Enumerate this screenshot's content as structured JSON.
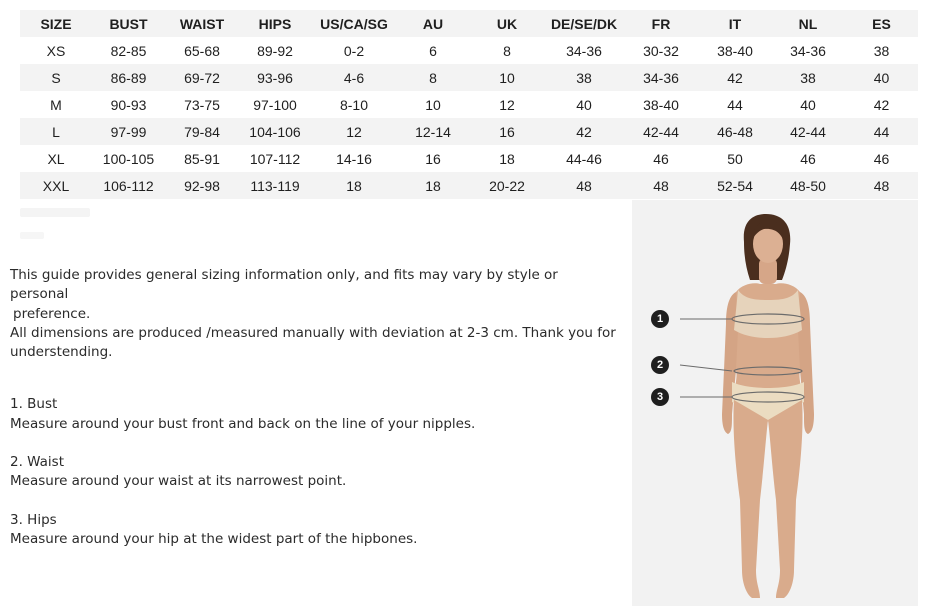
{
  "table": {
    "headers": [
      "SIZE",
      "BUST",
      "WAIST",
      "HIPS",
      "US/CA/SG",
      "AU",
      "UK",
      "DE/SE/DK",
      "FR",
      "IT",
      "NL",
      "ES"
    ],
    "rows": [
      [
        "XS",
        "82-85",
        "65-68",
        "89-92",
        "0-2",
        "6",
        "8",
        "34-36",
        "30-32",
        "38-40",
        "34-36",
        "38"
      ],
      [
        "S",
        "86-89",
        "69-72",
        "93-96",
        "4-6",
        "8",
        "10",
        "38",
        "34-36",
        "42",
        "38",
        "40"
      ],
      [
        "M",
        "90-93",
        "73-75",
        "97-100",
        "8-10",
        "10",
        "12",
        "40",
        "38-40",
        "44",
        "40",
        "42"
      ],
      [
        "L",
        "97-99",
        "79-84",
        "104-106",
        "12",
        "12-14",
        "16",
        "42",
        "42-44",
        "46-48",
        "42-44",
        "44"
      ],
      [
        "XL",
        "100-105",
        "85-91",
        "107-112",
        "14-16",
        "16",
        "18",
        "44-46",
        "46",
        "50",
        "46",
        "46"
      ],
      [
        "XXL",
        "106-112",
        "92-98",
        "113-119",
        "18",
        "18",
        "20-22",
        "48",
        "48",
        "52-54",
        "48-50",
        "48"
      ]
    ]
  },
  "guide": {
    "disclaimer_line1": "This guide provides general sizing information only, and fits may vary by style or personal",
    "disclaimer_line2": "preference.",
    "deviation_line1": "All dimensions are produced /measured manually with deviation at 2-3 cm. Thank you for",
    "deviation_line2": "understending.",
    "bust_title": "1. Bust",
    "bust_text": "Measure around your bust front and back on the line of your nipples.",
    "waist_title": "2. Waist",
    "waist_text": "Measure around your waist at its narrowest point.",
    "hips_title": "3. Hips",
    "hips_text": "Measure around your hip at the widest part of the hipbones."
  },
  "figure": {
    "marker_1": "1",
    "marker_2": "2",
    "marker_3": "3"
  },
  "colors": {
    "row_alt": "#f3f3f3",
    "panel_bg": "#f2f2f2",
    "marker": "#1f1f1f",
    "skin": "#d9ab8c",
    "garment": "#e6d3bb",
    "hair": "#4a2e1e"
  }
}
